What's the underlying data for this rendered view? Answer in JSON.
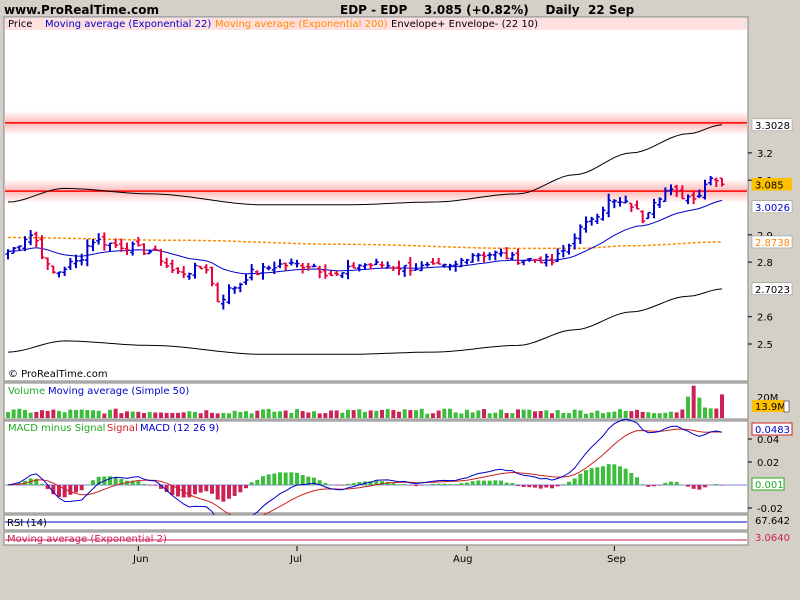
{
  "header": {
    "site": "www.ProRealTime.com",
    "instrument": "EDP - EDP",
    "price": "3.085 (+0.82%)",
    "period": "Daily",
    "date": "22 Sep"
  },
  "watermark": "© ProRealTime.com",
  "price_panel": {
    "legend": {
      "price": "Price",
      "ema22": "Moving average (Exponential 22)",
      "ema200": "Moving average (Exponential 200)",
      "envelope": "Envelope+ Envelope- (22 10)"
    },
    "tick_labels": [
      "3.2",
      "3.1",
      "2.9",
      "2.8",
      "2.6",
      "2.5"
    ],
    "tags": {
      "upper": "3.3028",
      "price": "3.085",
      "ema22": "3.0026",
      "ema200": "2.8738",
      "lower": "2.7023"
    }
  },
  "volume_panel": {
    "legend_volume": "Volume",
    "legend_ma": "Moving average (Simple 50)",
    "tag": "13.9M",
    "tag_top": "20M"
  },
  "macd_panel": {
    "legend_hist": "MACD minus Signal",
    "legend_signal": "Signal",
    "legend_macd": "MACD (12 26 9)",
    "tick_labels": [
      "0.04",
      "0.02",
      "-0.02"
    ],
    "tags": {
      "macd": "0.0483",
      "hist": "0.001"
    }
  },
  "rsi_panel": {
    "legend": "RSI (14)",
    "tag": "67.642"
  },
  "ema2_panel": {
    "legend": "Moving average (Exponential 2)",
    "tag": "3.0640"
  },
  "x_axis": {
    "labels": [
      "Jun",
      "Jul",
      "Aug",
      "Sep"
    ]
  },
  "colors": {
    "up": "#0000cc",
    "down": "#e8003a",
    "ema200": "#ff8c00",
    "envelope": "#000000",
    "volume": "#3cbe3c",
    "volume_down": "#cc2255",
    "hline": "#ff0000"
  },
  "chart_data": {
    "type": "candlestick",
    "ylim": [
      2.45,
      3.35
    ],
    "sessions": 127,
    "month_starts": {
      "Jun": 23,
      "Jul": 51,
      "Aug": 81,
      "Sep": 107
    },
    "close_anchors": [
      [
        0,
        2.84
      ],
      [
        4,
        2.9
      ],
      [
        8,
        2.76
      ],
      [
        12,
        2.8
      ],
      [
        15,
        2.88
      ],
      [
        20,
        2.86
      ],
      [
        25,
        2.84
      ],
      [
        30,
        2.76
      ],
      [
        35,
        2.78
      ],
      [
        37,
        2.66
      ],
      [
        40,
        2.71
      ],
      [
        43,
        2.76
      ],
      [
        48,
        2.79
      ],
      [
        53,
        2.79
      ],
      [
        58,
        2.75
      ],
      [
        62,
        2.79
      ],
      [
        66,
        2.79
      ],
      [
        70,
        2.78
      ],
      [
        74,
        2.78
      ],
      [
        78,
        2.78
      ],
      [
        82,
        2.83
      ],
      [
        86,
        2.83
      ],
      [
        90,
        2.81
      ],
      [
        94,
        2.81
      ],
      [
        96,
        2.8
      ],
      [
        98,
        2.84
      ],
      [
        101,
        2.92
      ],
      [
        104,
        2.98
      ],
      [
        106,
        3.02
      ],
      [
        110,
        3.01
      ],
      [
        112,
        2.96
      ],
      [
        114,
        3.03
      ],
      [
        116,
        3.06
      ],
      [
        120,
        3.04
      ],
      [
        122,
        3.05
      ],
      [
        124,
        3.12
      ],
      [
        126,
        3.085
      ]
    ],
    "envelope_upper_anchors": [
      [
        0,
        3.02
      ],
      [
        10,
        3.07
      ],
      [
        25,
        3.05
      ],
      [
        45,
        3.01
      ],
      [
        60,
        3.01
      ],
      [
        75,
        3.02
      ],
      [
        90,
        3.05
      ],
      [
        100,
        3.12
      ],
      [
        110,
        3.2
      ],
      [
        120,
        3.27
      ],
      [
        126,
        3.3028
      ]
    ],
    "ema200_anchors": [
      [
        0,
        2.89
      ],
      [
        30,
        2.88
      ],
      [
        60,
        2.865
      ],
      [
        90,
        2.85
      ],
      [
        100,
        2.85
      ],
      [
        110,
        2.86
      ],
      [
        126,
        2.8738
      ]
    ],
    "hlines": [
      3.31,
      3.06
    ],
    "macd_ylim": [
      -0.03,
      0.06
    ],
    "volume_ylim": [
      0,
      20000000
    ]
  }
}
